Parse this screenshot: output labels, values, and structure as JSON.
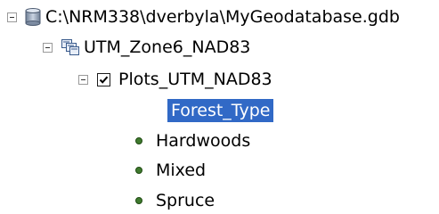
{
  "tree": {
    "geodatabase": {
      "label": "C:\\NRM338\\dverbyla\\MyGeodatabase.gdb",
      "icon": "database-icon"
    },
    "dataset": {
      "label": "UTM_Zone6_NAD83",
      "icon": "feature-dataset-icon"
    },
    "layer": {
      "label": "Plots_UTM_NAD83",
      "checked": true
    },
    "field": {
      "label": "Forest_Type"
    },
    "classes": [
      {
        "label": "Hardwoods",
        "color": "#3f7a2e"
      },
      {
        "label": "Mixed",
        "color": "#3f7a2e"
      },
      {
        "label": "Spruce",
        "color": "#3f7a2e"
      }
    ]
  },
  "colors": {
    "selection": "#3169c6",
    "text": "#000000"
  }
}
